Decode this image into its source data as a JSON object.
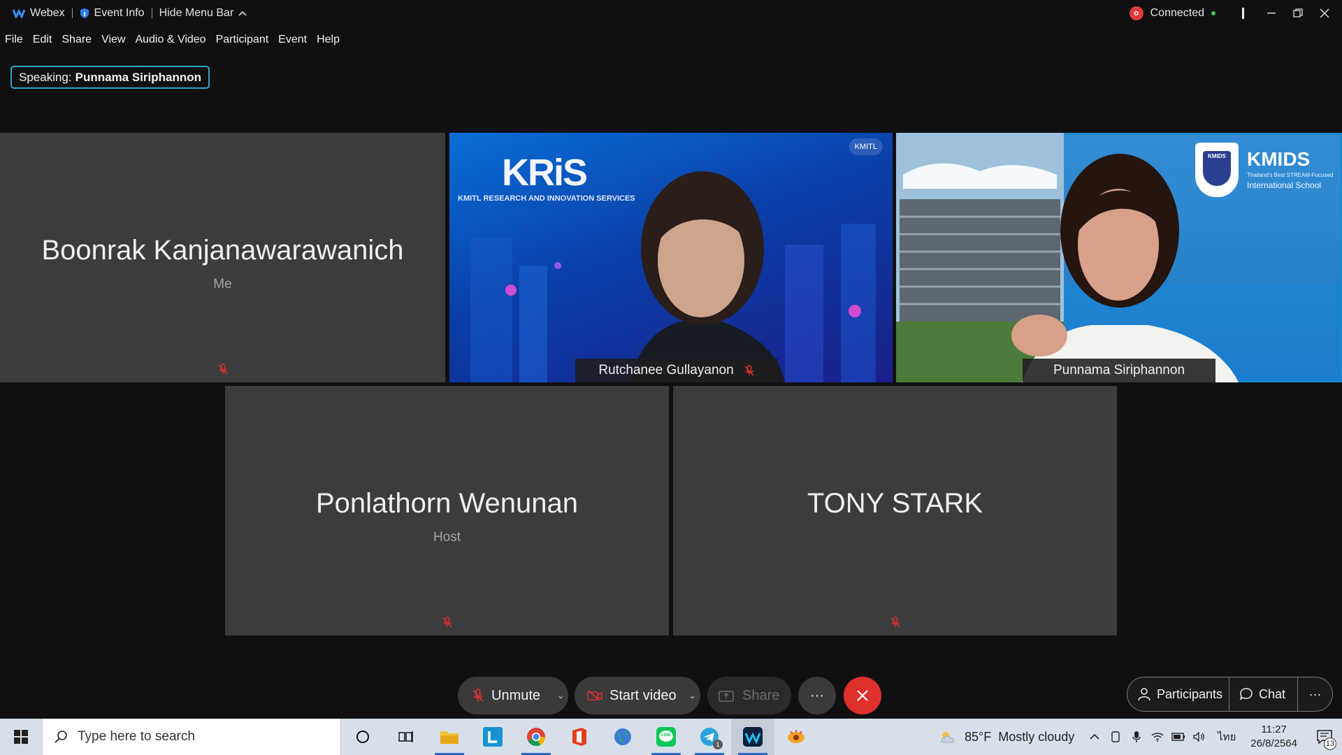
{
  "titlebar": {
    "app_name": "Webex",
    "event_info": "Event Info",
    "hide_menu": "Hide Menu Bar",
    "status": "Connected",
    "rec_glyph": "o"
  },
  "menu": [
    "File",
    "Edit",
    "Share",
    "View",
    "Audio & Video",
    "Participant",
    "Event",
    "Help"
  ],
  "speaking": {
    "label": "Speaking:",
    "name": "Punnama Siriphannon"
  },
  "tiles": {
    "boonrak": {
      "name": "Boonrak Kanjanawarawanich",
      "role": "Me"
    },
    "rutchanee": {
      "name": "Rutchanee Gullayanon"
    },
    "punnama": {
      "name": "Punnama Siriphannon"
    },
    "ponlathorn": {
      "name": "Ponlathorn Wenunan",
      "role": "Host"
    },
    "tony": {
      "name": "TONY STARK"
    }
  },
  "video_overlays": {
    "kris_logo": "KRiS",
    "kris_sub": "KMITL RESEARCH AND INNOVATION SERVICES",
    "kris_corner": "KMITL",
    "kmids_logo": "KMIDS",
    "kmids_sub1": "Thailand's Best STREAM-Focused",
    "kmids_sub2": "International School",
    "kmids_shield": "KMIDS"
  },
  "controls": {
    "unmute": "Unmute",
    "start_video": "Start video",
    "share": "Share",
    "more": "···",
    "participants": "Participants",
    "chat": "Chat",
    "side_more": "···"
  },
  "taskbar": {
    "search_placeholder": "Type here to search",
    "line_label": "LINE",
    "telegram_badge": "1",
    "weather_temp": "85°F",
    "weather_desc": "Mostly cloudy",
    "lang": "ไทย",
    "time": "11:27",
    "date": "26/8/2564",
    "notif_count": "13"
  },
  "colors": {
    "accent": "#1fb8e6",
    "end_call": "#e0302b",
    "muted_red": "#e0302b",
    "tile_bg": "#3c3c3c"
  }
}
